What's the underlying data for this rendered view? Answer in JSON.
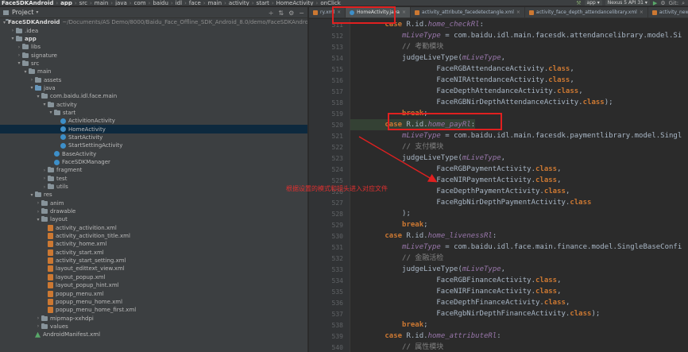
{
  "breadcrumbs": [
    "FaceSDKAndroid",
    "app",
    "src",
    "main",
    "java",
    "com",
    "baidu",
    "idl",
    "face",
    "main",
    "activity",
    "start",
    "HomeActivity",
    "onClick"
  ],
  "toolbar": {
    "run_config": "app",
    "device": "Nexus 5 API 31",
    "git_label": "Git:"
  },
  "project_panel": {
    "title": "Project",
    "tree": [
      {
        "indent": 0,
        "arrow": "down",
        "icon": "folder",
        "label": "FaceSDKAndroid",
        "path": "~/Documents/AS Demo/8000/Baidu_Face_Offline_SDK_Android_8.0/demo/FaceSDKAndroid",
        "bold": true
      },
      {
        "indent": 1,
        "arrow": "right",
        "icon": "folder",
        "label": ".idea"
      },
      {
        "indent": 1,
        "arrow": "down",
        "icon": "folder",
        "label": "app",
        "bold": true
      },
      {
        "indent": 2,
        "arrow": "right",
        "icon": "folder",
        "label": "libs"
      },
      {
        "indent": 2,
        "arrow": "right",
        "icon": "folder",
        "label": "signature"
      },
      {
        "indent": 2,
        "arrow": "down",
        "icon": "folder",
        "label": "src"
      },
      {
        "indent": 3,
        "arrow": "down",
        "icon": "folder",
        "label": "main"
      },
      {
        "indent": 4,
        "arrow": "right",
        "icon": "folder",
        "label": "assets"
      },
      {
        "indent": 4,
        "arrow": "down",
        "icon": "folder-blue",
        "label": "java"
      },
      {
        "indent": 5,
        "arrow": "down",
        "icon": "folder",
        "label": "com.baidu.idl.face.main"
      },
      {
        "indent": 6,
        "arrow": "down",
        "icon": "folder",
        "label": "activity"
      },
      {
        "indent": 7,
        "arrow": "down",
        "icon": "folder",
        "label": "start"
      },
      {
        "indent": 8,
        "arrow": "none",
        "icon": "class",
        "label": "ActivitionActivity"
      },
      {
        "indent": 8,
        "arrow": "none",
        "icon": "class",
        "label": "HomeActivity",
        "selected": true
      },
      {
        "indent": 8,
        "arrow": "none",
        "icon": "class",
        "label": "StartActivity"
      },
      {
        "indent": 8,
        "arrow": "none",
        "icon": "class",
        "label": "StartSettingActivity"
      },
      {
        "indent": 7,
        "arrow": "none",
        "icon": "class",
        "label": "BaseActivity"
      },
      {
        "indent": 7,
        "arrow": "none",
        "icon": "class",
        "label": "FaceSDKManager"
      },
      {
        "indent": 6,
        "arrow": "right",
        "icon": "folder",
        "label": "fragment"
      },
      {
        "indent": 6,
        "arrow": "right",
        "icon": "folder",
        "label": "test"
      },
      {
        "indent": 6,
        "arrow": "right",
        "icon": "folder",
        "label": "utils"
      },
      {
        "indent": 4,
        "arrow": "down",
        "icon": "folder",
        "label": "res"
      },
      {
        "indent": 5,
        "arrow": "right",
        "icon": "folder",
        "label": "anim"
      },
      {
        "indent": 5,
        "arrow": "right",
        "icon": "folder",
        "label": "drawable"
      },
      {
        "indent": 5,
        "arrow": "down",
        "icon": "folder",
        "label": "layout"
      },
      {
        "indent": 6,
        "arrow": "none",
        "icon": "xml",
        "label": "activity_activition.xml"
      },
      {
        "indent": 6,
        "arrow": "none",
        "icon": "xml",
        "label": "activity_activition_title.xml"
      },
      {
        "indent": 6,
        "arrow": "none",
        "icon": "xml",
        "label": "activity_home.xml"
      },
      {
        "indent": 6,
        "arrow": "none",
        "icon": "xml",
        "label": "activity_start.xml"
      },
      {
        "indent": 6,
        "arrow": "none",
        "icon": "xml",
        "label": "activity_start_setting.xml"
      },
      {
        "indent": 6,
        "arrow": "none",
        "icon": "xml",
        "label": "layout_edittext_view.xml"
      },
      {
        "indent": 6,
        "arrow": "none",
        "icon": "xml",
        "label": "layout_popup.xml"
      },
      {
        "indent": 6,
        "arrow": "none",
        "icon": "xml",
        "label": "layout_popup_hint.xml"
      },
      {
        "indent": 6,
        "arrow": "none",
        "icon": "xml",
        "label": "popup_menu.xml"
      },
      {
        "indent": 6,
        "arrow": "none",
        "icon": "xml",
        "label": "popup_menu_home.xml"
      },
      {
        "indent": 6,
        "arrow": "none",
        "icon": "xml",
        "label": "popup_menu_home_first.xml"
      },
      {
        "indent": 5,
        "arrow": "right",
        "icon": "folder",
        "label": "mipmap-xxhdpi"
      },
      {
        "indent": 5,
        "arrow": "right",
        "icon": "folder",
        "label": "values"
      },
      {
        "indent": 4,
        "arrow": "none",
        "icon": "manifest",
        "label": "AndroidManifest.xml"
      }
    ]
  },
  "editor_tabs": [
    {
      "label": "ry.xml",
      "icon": "xml",
      "active": false
    },
    {
      "label": "HomeActivity.java",
      "icon": "class",
      "active": true
    },
    {
      "label": "activity_attribute_facedetectangle.xml",
      "icon": "xml",
      "active": false
    },
    {
      "label": "activity_face_depth_attendancelibrary.xml",
      "icon": "xml",
      "active": false
    },
    {
      "label": "activity_new_registerlibrary.xml",
      "icon": "xml",
      "active": false
    }
  ],
  "code_lines": [
    {
      "n": "511",
      "html": "        <span class=\"kw\">case</span> R.id.<span class=\"fld\">home_checkRl</span>:"
    },
    {
      "n": "512",
      "html": "            <span class=\"fld\">mLiveType</span> = com.baidu.idl.main.facesdk.attendancelibrary.model.Si"
    },
    {
      "n": "513",
      "html": "            <span class=\"cm\">// 考勤模块</span>"
    },
    {
      "n": "514",
      "html": "            judgeLiveType(<span class=\"fld\">mLiveType</span>,"
    },
    {
      "n": "515",
      "html": "                    FaceRGBAttendanceActivity.<span class=\"kw\">class</span>,"
    },
    {
      "n": "516",
      "html": "                    FaceNIRAttendanceActivity.<span class=\"kw\">class</span>,"
    },
    {
      "n": "517",
      "html": "                    FaceDepthAttendanceActivity.<span class=\"kw\">class</span>,"
    },
    {
      "n": "518",
      "html": "                    FaceRGBNirDepthAttendanceActivity.<span class=\"kw\">class</span>);"
    },
    {
      "n": "519",
      "html": "            <span class=\"kw\">break</span>;"
    },
    {
      "n": "520",
      "html": "        <span class=\"kw\">case</span> R.id.<span class=\"fld\">home_payRl</span>:",
      "hl": true
    },
    {
      "n": "521",
      "html": "            <span class=\"fld\">mLiveType</span> = com.baidu.idl.main.facesdk.paymentlibrary.model.Singl"
    },
    {
      "n": "522",
      "html": "            <span class=\"cm\">// 支付模块</span>"
    },
    {
      "n": "523",
      "html": "            judgeLiveType(<span class=\"fld\">mLiveType</span>,"
    },
    {
      "n": "524",
      "html": "                    FaceRGBPaymentActivity.<span class=\"kw\">class</span>,"
    },
    {
      "n": "525",
      "html": "                    FaceNIRPaymentActivity.<span class=\"kw\">class</span>,"
    },
    {
      "n": "526",
      "html": "                    FaceDepthPaymentActivity.<span class=\"kw\">class</span>,"
    },
    {
      "n": "527",
      "html": "                    FaceRgbNirDepthPaymentActivity.<span class=\"kw\">class</span>"
    },
    {
      "n": "528",
      "html": "            );"
    },
    {
      "n": "529",
      "html": "            <span class=\"kw\">break</span>;"
    },
    {
      "n": "530",
      "html": "        <span class=\"kw\">case</span> R.id.<span class=\"fld\">home_livenessRl</span>:"
    },
    {
      "n": "531",
      "html": "            <span class=\"fld\">mLiveType</span> = com.baidu.idl.face.main.finance.model.SingleBaseConfi"
    },
    {
      "n": "532",
      "html": "            <span class=\"cm\">// 金融活检</span>"
    },
    {
      "n": "533",
      "html": "            judgeLiveType(<span class=\"fld\">mLiveType</span>,"
    },
    {
      "n": "534",
      "html": "                    FaceRGBFinanceActivity.<span class=\"kw\">class</span>,"
    },
    {
      "n": "535",
      "html": "                    FaceNIRFinanceActivity.<span class=\"kw\">class</span>,"
    },
    {
      "n": "536",
      "html": "                    FaceDepthFinanceActivity.<span class=\"kw\">class</span>,"
    },
    {
      "n": "537",
      "html": "                    FaceRgbNirDepthFinanceActivity.<span class=\"kw\">class</span>);"
    },
    {
      "n": "538",
      "html": "            <span class=\"kw\">break</span>;"
    },
    {
      "n": "539",
      "html": "        <span class=\"kw\">case</span> R.id.<span class=\"fld\">home_attributeRl</span>:"
    },
    {
      "n": "540",
      "html": "            <span class=\"cm\">// 属性模块</span>"
    }
  ],
  "annotation": {
    "text": "根据设置的模式和镜头进入对应文件",
    "color": "#e02020"
  },
  "colors": {
    "keyword": "#cc7832",
    "field": "#9876aa",
    "comment": "#808080",
    "panel_bg": "#3c3f41",
    "editor_bg": "#2b2b2b",
    "selection": "#0d293e"
  }
}
